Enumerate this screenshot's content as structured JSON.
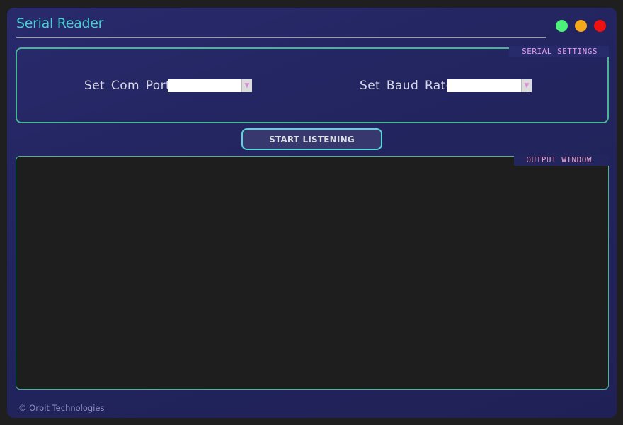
{
  "window": {
    "title": "Serial Reader",
    "controls": [
      "green-dot",
      "yellow-dot",
      "red-dot"
    ],
    "colors": {
      "title": "#46cfd0",
      "accent_border": "#49b595",
      "legend_text": "#e39ee6",
      "window_bg": "#262866"
    }
  },
  "settings": {
    "legend": "SERIAL SETTINGS",
    "com_port": {
      "label": "Set Com Port",
      "selected": ""
    },
    "baud_rate": {
      "label": "Set Baud Rate",
      "selected": ""
    }
  },
  "actions": {
    "start_label": "START LISTENING"
  },
  "output": {
    "legend": "OUTPUT WINDOW",
    "content": ""
  },
  "footer": {
    "text": "© Orbit Technologies"
  }
}
